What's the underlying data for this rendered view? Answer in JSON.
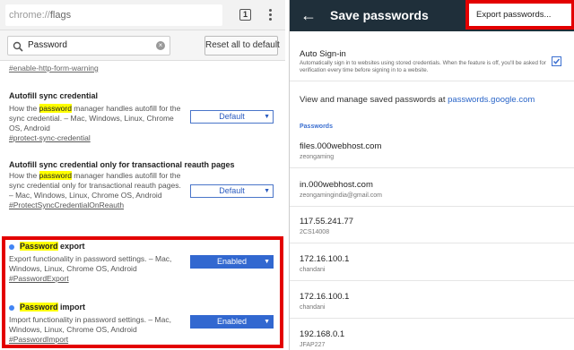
{
  "left": {
    "url": {
      "scheme": "chrome://",
      "path": "flags"
    },
    "tab_count": "1",
    "search": {
      "value": "Password"
    },
    "reset_label": "Reset all to default",
    "top_anchor": "#enable-http-form-warning",
    "flags": [
      {
        "title": "Autofill sync credential",
        "desc_pre": "How the ",
        "desc_hl": "password",
        "desc_post": " manager handles autofill for the sync credential. – Mac, Windows, Linux, Chrome OS, Android",
        "anchor": "#protect-sync-credential",
        "value": "Default"
      },
      {
        "title": "Autofill sync credential only for transactional reauth pages",
        "desc_pre": "How the ",
        "desc_hl": "password",
        "desc_post": " manager handles autofill for the sync credential only for transactional reauth pages. – Mac, Windows, Linux, Chrome OS, Android",
        "anchor": "#ProtectSyncCredentialOnReauth",
        "value": "Default"
      },
      {
        "title_hl": "Password",
        "title_post": " export",
        "desc": "Export functionality in password settings. – Mac, Windows, Linux, Chrome OS, Android",
        "anchor": "#PasswordExport",
        "value": "Enabled"
      },
      {
        "title_hl": "Password",
        "title_post": " import",
        "desc": "Import functionality in password settings. – Mac, Windows, Linux, Chrome OS, Android",
        "anchor": "#PasswordImport",
        "value": "Enabled"
      }
    ]
  },
  "right": {
    "title": "Save passwords",
    "export_label": "Export passwords...",
    "auto_signin": {
      "title": "Auto Sign-in",
      "desc": "Automatically sign in to websites using stored credentials. When the feature is off, you'll be asked for verification every time before signing in to a website.",
      "checked": true
    },
    "manage": {
      "pre": "View and manage saved passwords at ",
      "link": "passwords.google.com"
    },
    "section_label": "Passwords",
    "entries": [
      {
        "site": "files.000webhost.com",
        "user": "zeongaming"
      },
      {
        "site": "in.000webhost.com",
        "user": "zeongamingindia@gmail.com"
      },
      {
        "site": "117.55.241.77",
        "user": "2CS14008"
      },
      {
        "site": "172.16.100.1",
        "user": "chandani"
      },
      {
        "site": "172.16.100.1",
        "user": "chandani"
      },
      {
        "site": "192.168.0.1",
        "user": "JFAP227"
      }
    ]
  },
  "colors": {
    "highlight_box": "#e30000",
    "appbar": "#1f2f3a",
    "accent": "#3268d0",
    "text_highlight": "#ffff00"
  }
}
